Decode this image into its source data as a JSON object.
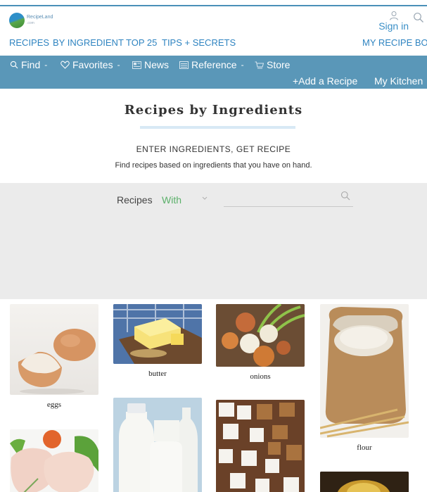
{
  "header": {
    "logo_text": "RecipeLand",
    "logo_sub": ".com",
    "signin_label": "Sign in"
  },
  "nav_primary": [
    {
      "label": "RECIPES"
    },
    {
      "label": "BY INGREDIENT"
    },
    {
      "label": "TOP 25"
    },
    {
      "label": "TIPS + SECRETS"
    },
    {
      "label": "MY RECIPE BOX"
    }
  ],
  "nav_secondary": {
    "find": "Find",
    "favorites": "Favorites",
    "news": "News",
    "reference": "Reference",
    "store": "Store",
    "dash": "-",
    "add_recipe": "+Add a Recipe",
    "my_kitchen": "My Kitchen"
  },
  "page": {
    "title": "Recipes by Ingredients",
    "headline": "ENTER INGREDIENTS, GET RECIPE",
    "subline": "Find recipes based on ingredients that you have on hand."
  },
  "search": {
    "recipes_label": "Recipes",
    "mode_value": "With",
    "input_value": ""
  },
  "ingredients": [
    {
      "label": "eggs"
    },
    {
      "label": "butter"
    },
    {
      "label": "onions"
    },
    {
      "label": "flour"
    },
    {
      "label": ""
    },
    {
      "label": ""
    },
    {
      "label": ""
    },
    {
      "label": ""
    }
  ],
  "colors": {
    "accent_blue": "#2f84c1",
    "nav_bar": "#5a97b8",
    "with_green": "#5bb06a",
    "search_panel": "#ebebeb"
  }
}
